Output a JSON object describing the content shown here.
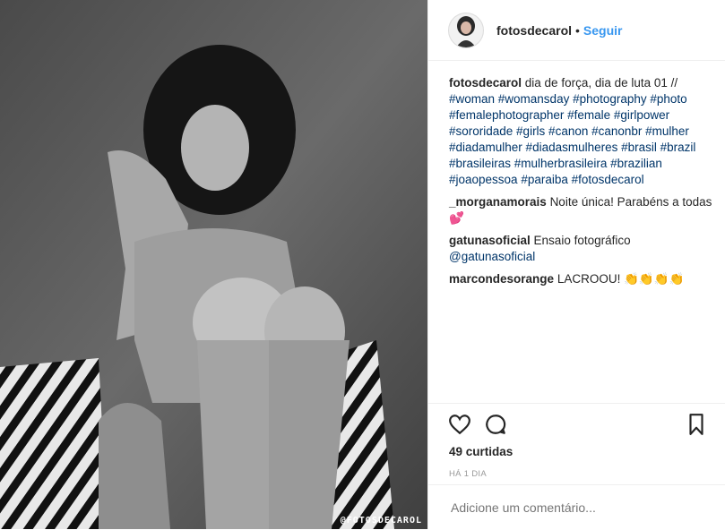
{
  "post": {
    "watermark": "@FOTOSDECAROL"
  },
  "header": {
    "username": "fotosdecarol",
    "separator": "•",
    "follow_label": "Seguir"
  },
  "comments": [
    {
      "user": "fotosdecarol",
      "text": "dia de força, dia de luta 01 //",
      "tags": "#woman #womansday #photography #photo #femalephotographer #female #girlpower #sororidade #girls #canon #canonbr #mulher #diadamulher #diadasmulheres #brasil #brazil #brasileiras #mulherbrasileira #brazilian #joaopessoa #paraiba #fotosdecarol"
    },
    {
      "user": "_morganamorais",
      "text": "Noite única! Parabéns a todas💕"
    },
    {
      "user": "gatunasoficial",
      "text": "Ensaio fotográfico",
      "mention": "@gatunasoficial"
    },
    {
      "user": "marcondesorange",
      "text": "LACROOU! 👏👏👏👏"
    }
  ],
  "actions": {
    "likes_label": "49 curtidas",
    "time_label": "HÁ 1 DIA"
  },
  "add_comment": {
    "placeholder": "Adicione um comentário..."
  }
}
